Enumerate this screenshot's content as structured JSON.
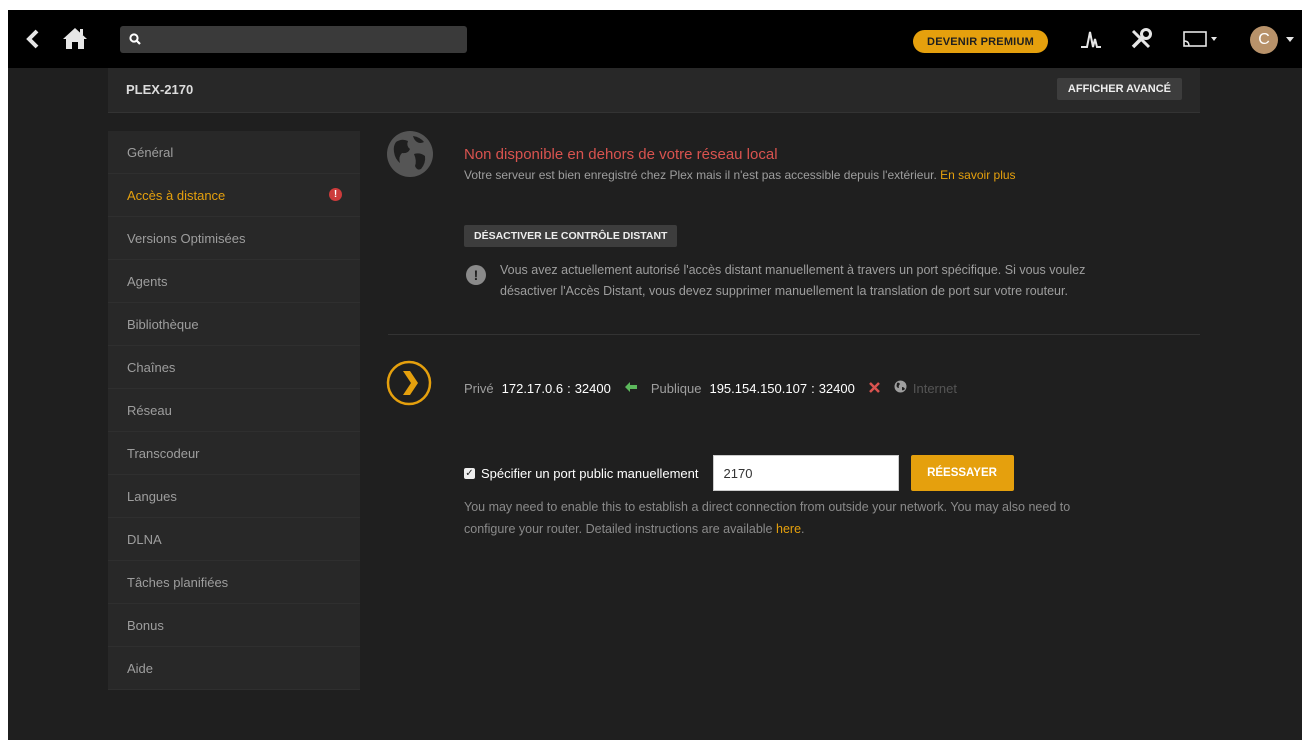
{
  "topbar": {
    "search_placeholder": "",
    "premium_label": "DEVENIR PREMIUM",
    "avatar_initial": "C"
  },
  "server": {
    "name": "PLEX-2170",
    "advanced_label": "AFFICHER AVANCÉ"
  },
  "sidebar": {
    "items": [
      {
        "label": "Général"
      },
      {
        "label": "Accès à distance"
      },
      {
        "label": "Versions Optimisées"
      },
      {
        "label": "Agents"
      },
      {
        "label": "Bibliothèque"
      },
      {
        "label": "Chaînes"
      },
      {
        "label": "Réseau"
      },
      {
        "label": "Transcodeur"
      },
      {
        "label": "Langues"
      },
      {
        "label": "DLNA"
      },
      {
        "label": "Tâches planifiées"
      },
      {
        "label": "Bonus"
      },
      {
        "label": "Aide"
      }
    ],
    "warning_glyph": "!"
  },
  "status": {
    "title": "Non disponible en dehors de votre réseau local",
    "description": "Votre serveur est bien enregistré chez Plex mais il n'est pas accessible depuis l'extérieur.",
    "learn_more": "En savoir plus"
  },
  "disable_button": "DÉSACTIVER LE CONTRÔLE DISTANT",
  "info": {
    "glyph": "!",
    "line1": "Vous avez actuellement autorisé l'accès distant manuellement à travers un port spécifique. Si vous voulez",
    "line2": "désactiver l'Accès Distant, vous devez supprimer manuellement la translation de port sur votre routeur."
  },
  "connection": {
    "private_label": "Privé",
    "private_ip": "172.17.0.6",
    "private_port": "32400",
    "public_label": "Publique",
    "public_ip": "195.154.150.107",
    "public_port": "32400",
    "internet_label": "Internet",
    "separator": ":"
  },
  "manual_port": {
    "checkbox_label": "Spécifier un port public manuellement",
    "checked": true,
    "value": "2170",
    "retry_label": "RÉESSAYER"
  },
  "help": {
    "line1": "You may need to enable this to establish a direct connection from outside your network. You may also need to",
    "line2": "configure your router. Detailed instructions are available",
    "link": "here",
    "end": "."
  },
  "colors": {
    "accent": "#e5a00d",
    "error": "#d9534f",
    "success": "#5cb85c",
    "background": "#1f1f1f",
    "topbar": "#000000"
  },
  "icons": [
    "back-icon",
    "home-icon",
    "search-icon",
    "activity-icon",
    "settings-icon",
    "cast-icon",
    "globe-icon",
    "plex-chevron-icon",
    "warning-icon",
    "arrow-left-icon",
    "close-icon",
    "globe-small-icon"
  ]
}
